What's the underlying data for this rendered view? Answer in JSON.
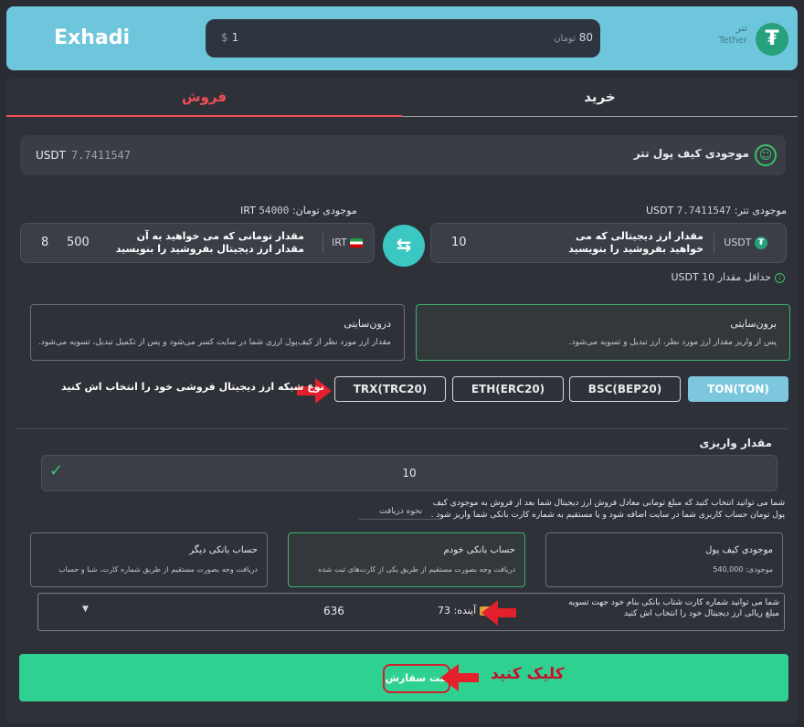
{
  "header": {
    "brand": "Exhadi",
    "usd_symbol": "$",
    "usd_value": "1",
    "irt_value": "80",
    "irt_unit": "تومان",
    "coin_fa": "تتر",
    "coin_en": "Tether",
    "coin_icon": "tether-icon"
  },
  "tabs": {
    "buy": "خرید",
    "sell": "فروش"
  },
  "wallet": {
    "label": "موجودی کیف پول تتر",
    "currency": "USDT",
    "amount": "7.7411547",
    "icon": "smile-icon"
  },
  "balances": {
    "tether_label": "موجودی تتر:",
    "tether_amount": "7.7411547",
    "tether_currency": "USDT",
    "toman_label": "موجودی تومان:",
    "toman_amount": "54",
    "toman_amount_suffix": "000",
    "toman_currency": "IRT"
  },
  "sell_box": {
    "currency": "USDT",
    "hint": "مقدار ارز دیجیتالی که می خواهید بفروشید را بنویسید",
    "value": "10"
  },
  "receive_box": {
    "currency": "IRT",
    "hint": "مقدار تومانی که می خواهید به آن مقدار ارز دیجیتال بفروشید را بنویسید",
    "value": "500",
    "value_prefix": "8"
  },
  "min_amount": "حداقل مقدار USDT 10",
  "options": {
    "external_title": "برون‌سایتی",
    "external_desc": "پس از واریز مقدار ارز مورد نظر، ارز تبدیل و تسویه می‌شود.",
    "internal_title": "درون‌سایتی",
    "internal_desc": "مقدار ارز مورد نظر از کیف‌پول ارزی شما در سایت کسر می‌شود و پس از تکمیل تبدیل، تسویه می‌شود."
  },
  "networks": {
    "ton": "TON(TON)",
    "bsc": "BSC(BEP20)",
    "eth": "ETH(ERC20)",
    "trx": "TRX(TRC20)",
    "label": "نوع شبکه ارز دیجیتال فروشی خود را انتخاب اش کنید"
  },
  "deposit": {
    "label": "مقدار واریزی",
    "value": "10"
  },
  "note": "شما می توانید انتخاب کنید که مبلغ تومانی معادل فروش ارز دیجیتال شما بعد از فروش به موجودی کیف پول تومان حساب کاربری شما در سایت اضافه شود و یا مستقیم به شماره کارت بانکی شما واریز شود .",
  "how_label": "نحوه دریافت",
  "payment": {
    "wallet_title": "موجودی کیف پول",
    "wallet_desc": "موجودی: 540,000",
    "mine_title": "حساب بانکی خودم",
    "mine_desc": "دریافت وجه بصورت مستقیم از طریق یکی از کارت‌های ثبت شده",
    "other_title": "حساب بانکی دیگر",
    "other_desc": "دریافت وجه بصورت مستقیم از طریق شماره کارت، شبا و حساب"
  },
  "card_select": {
    "number": "636",
    "holder": "آینده: 73",
    "note": "شما می توانید شماره کارت شتاب بانکی بنام خود جهت تسویه مبلغ ریالی ارز دیجیتال خود را انتخاب اش کنید"
  },
  "submit": {
    "label": "ثبت سفارش",
    "click_note": "کلیک کنید"
  },
  "colors": {
    "header_bg": "#6ec6dd",
    "accent_green": "#2fd190",
    "sell_red": "#ef4e58",
    "annotation_red": "#d01f2a"
  }
}
